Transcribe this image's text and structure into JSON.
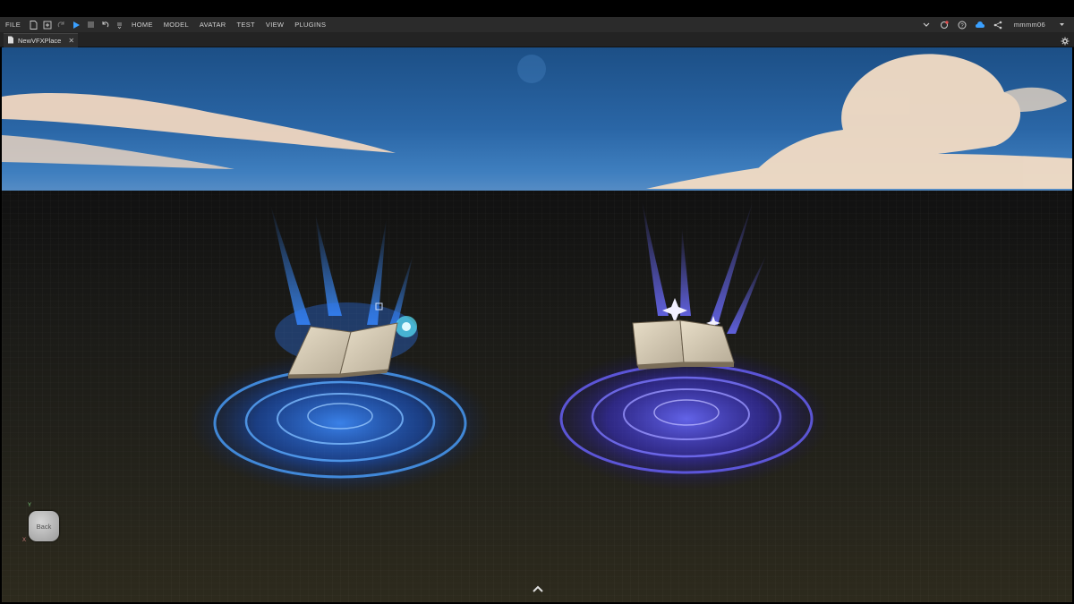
{
  "menubar": {
    "file_label": "FILE",
    "items": [
      "HOME",
      "MODEL",
      "AVATAR",
      "TEST",
      "VIEW",
      "PLUGINS"
    ],
    "username": "mmmm06"
  },
  "tabs": [
    {
      "label": "NewVFXPlace",
      "icon": "document-icon",
      "close": "✕"
    }
  ],
  "viewport": {
    "view_cube_label": "Back",
    "axis_y": "Y",
    "axis_x": "X",
    "book_left_color": "#1e6bff",
    "book_right_color": "#4a3dff"
  },
  "colors": {
    "menubar_bg": "#2b2b2b",
    "tabbar_bg": "#232323",
    "accent_play": "#3aa0ff"
  }
}
